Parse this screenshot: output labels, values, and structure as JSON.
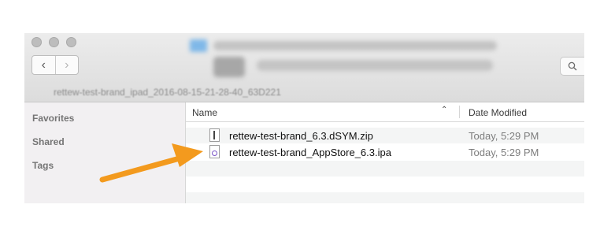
{
  "window": {
    "path_text": "rettew-test-brand_ipad_2016-08-15-21-28-40_63D221"
  },
  "sidebar": {
    "items": [
      {
        "label": "Favorites"
      },
      {
        "label": "Shared"
      },
      {
        "label": "Tags"
      }
    ]
  },
  "table": {
    "columns": {
      "name": "Name",
      "date": "Date Modified"
    },
    "rows": [
      {
        "name": "rettew-test-brand_6.3.dSYM.zip",
        "date": "Today, 5:29 PM",
        "icon": "zip-file-icon"
      },
      {
        "name": "rettew-test-brand_AppStore_6.3.ipa",
        "date": "Today, 5:29 PM",
        "icon": "ipa-file-icon"
      }
    ]
  },
  "annotation": {
    "arrow_color": "#f39a1e"
  },
  "icons": {
    "back": "chevron-left-icon",
    "forward": "chevron-right-icon",
    "search": "search-icon"
  }
}
